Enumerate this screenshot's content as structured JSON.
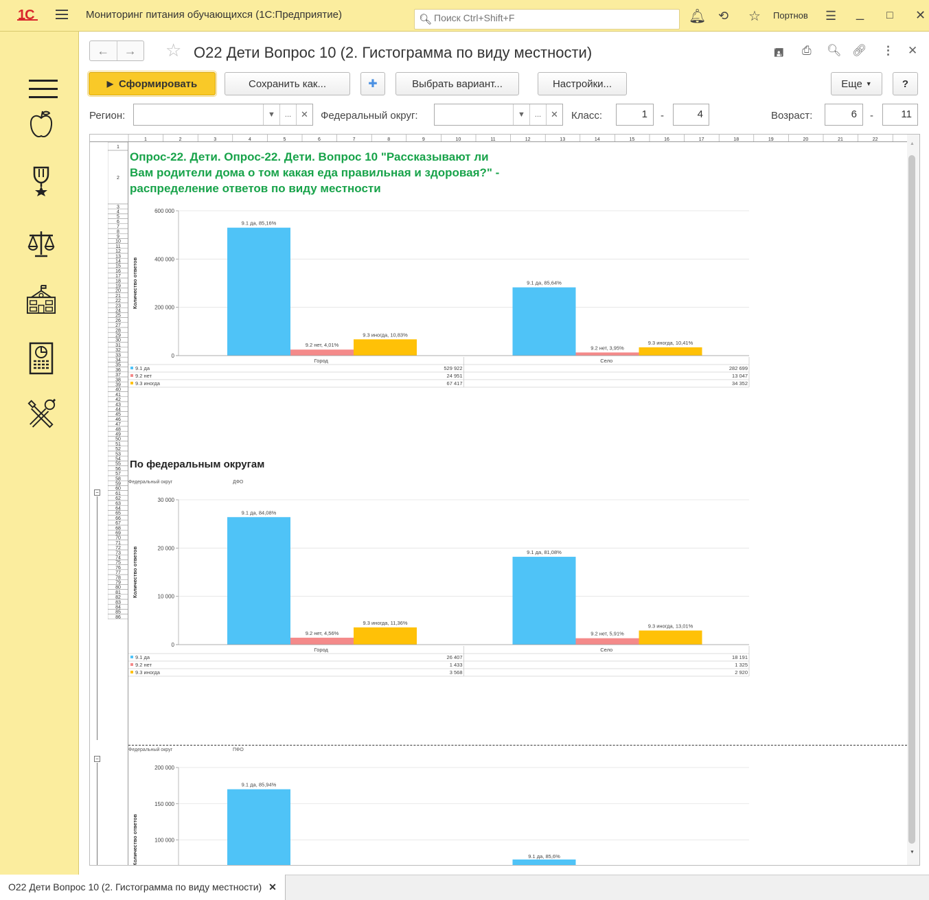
{
  "app": {
    "title": "Мониторинг питания обучающихся  (1С:Предприятие)",
    "search_placeholder": "Поиск Ctrl+Shift+F",
    "user": "Портнов"
  },
  "form": {
    "title": "О22 Дети Вопрос 10 (2. Гистограмма по виду местности)"
  },
  "toolbar": {
    "generate": "Сформировать",
    "save_as": "Сохранить как...",
    "choose_variant": "Выбрать вариант...",
    "settings": "Настройки...",
    "more": "Еще",
    "help": "?"
  },
  "filters": {
    "region_label": "Регион:",
    "fed_district_label": "Федеральный округ:",
    "class_label": "Класс:",
    "class_from": "1",
    "class_dash": "-",
    "class_to": "4",
    "age_label": "Возраст:",
    "age_from": "6",
    "age_dash": "-",
    "age_to": "11"
  },
  "report": {
    "title": "Опрос-22. Дети. Опрос-22. Дети. Вопрос 10 \"Рассказывают ли Вам родители дома о том какая еда правильная и здоровая?\" - распределение ответов по виду местности",
    "section_title": "По федеральным округам",
    "fd_label": "Федеральный округ"
  },
  "colors": {
    "yes": "#4fc3f7",
    "no": "#f48a8a",
    "sometimes": "#ffc107"
  },
  "tab_label": "О22 Дети Вопрос 10 (2. Гистограмма по виду местности)",
  "chart_data": [
    {
      "type": "bar",
      "district": "",
      "ylabel": "Количество ответов",
      "categories": [
        "Город",
        "Село"
      ],
      "ylim": [
        0,
        600000
      ],
      "yticks": [
        0,
        200000,
        400000,
        600000
      ],
      "series": [
        {
          "name": "9.1 да",
          "values": [
            529922,
            282699
          ],
          "labels": [
            "9.1 да, 85,16%",
            "9.1 да, 85,64%"
          ]
        },
        {
          "name": "9.2 нет",
          "values": [
            24951,
            13047
          ],
          "labels": [
            "9.2 нет, 4,01%",
            "9.2 нет, 3,95%"
          ]
        },
        {
          "name": "9.3 иногда",
          "values": [
            67417,
            34352
          ],
          "labels": [
            "9.3 иногда, 10,83%",
            "9.3 иногда, 10,41%"
          ]
        }
      ],
      "table": [
        [
          "529 922",
          "282 699"
        ],
        [
          "24 951",
          "13 047"
        ],
        [
          "67 417",
          "34 352"
        ]
      ]
    },
    {
      "type": "bar",
      "district": "ДФО",
      "ylabel": "Количество ответов",
      "categories": [
        "Город",
        "Село"
      ],
      "ylim": [
        0,
        30000
      ],
      "yticks": [
        0,
        10000,
        20000,
        30000
      ],
      "series": [
        {
          "name": "9.1 да",
          "values": [
            26407,
            18191
          ],
          "labels": [
            "9.1 да, 84,08%",
            "9.1 да, 81,08%"
          ]
        },
        {
          "name": "9.2 нет",
          "values": [
            1433,
            1325
          ],
          "labels": [
            "9.2 нет, 4,56%",
            "9.2 нет, 5,91%"
          ]
        },
        {
          "name": "9.3 иногда",
          "values": [
            3568,
            2920
          ],
          "labels": [
            "9.3 иногда, 11,36%",
            "9.3 иногда, 13,01%"
          ]
        }
      ],
      "table": [
        [
          "26 407",
          "18 191"
        ],
        [
          "1 433",
          "1 325"
        ],
        [
          "3 568",
          "2 920"
        ]
      ]
    },
    {
      "type": "bar",
      "district": "ПФО",
      "ylabel": "Количество ответов",
      "categories": [
        "Город",
        "Село"
      ],
      "ylim": [
        0,
        200000
      ],
      "yticks": [
        100000,
        150000,
        200000
      ],
      "series": [
        {
          "name": "9.1 да",
          "values": [
            170000,
            null
          ],
          "labels": [
            "9.1 да, 85,94%",
            "9.1 да, 85,6%"
          ]
        }
      ],
      "table": []
    }
  ]
}
